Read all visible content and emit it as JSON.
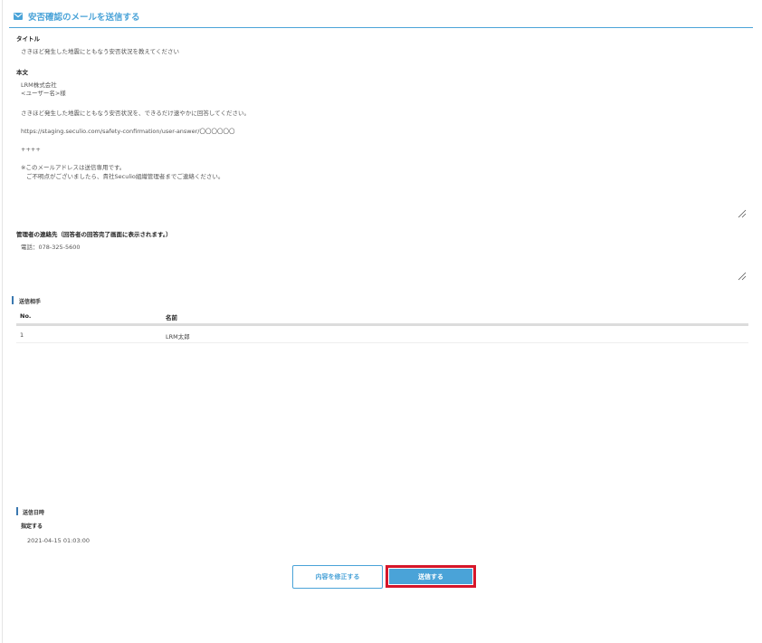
{
  "header": {
    "title": "安否確認のメールを送信する",
    "icon": "mail-icon"
  },
  "form": {
    "title_label": "タイトル",
    "title_value": "さきほど発生した地震にともなう安否状況を教えてください",
    "body_label": "本文",
    "body_lines": [
      "LRM株式会社",
      "<ユーザー名>様",
      "さきほど発生した地震にともなう安否状況を、できるだけ速やかに回答してください。",
      "https://staging.seculio.com/safety-confirmation/user-answer/〇〇〇〇〇〇",
      "++++",
      "※このメールアドレスは送信専用です。",
      "ご不明点がございましたら、貴社Seculio組織管理者までご連絡ください。"
    ],
    "contact_label": "管理者の連絡先（回答者の回答完了画面に表示されます。）",
    "contact_value": "電話：078-325-5600"
  },
  "recipients": {
    "section_title": "送信相手",
    "columns": [
      "No.",
      "名前"
    ],
    "rows": [
      {
        "no": "1",
        "name": "LRM太郎"
      }
    ]
  },
  "schedule": {
    "section_title": "送信日時",
    "mode_label": "指定する",
    "datetime": "2021-04-15 01:03:00"
  },
  "actions": {
    "edit_label": "内容を修正する",
    "send_label": "送信する"
  },
  "colors": {
    "accent": "#4aa3d8",
    "highlight": "#d6162a",
    "section_bar": "#3a78b0"
  }
}
